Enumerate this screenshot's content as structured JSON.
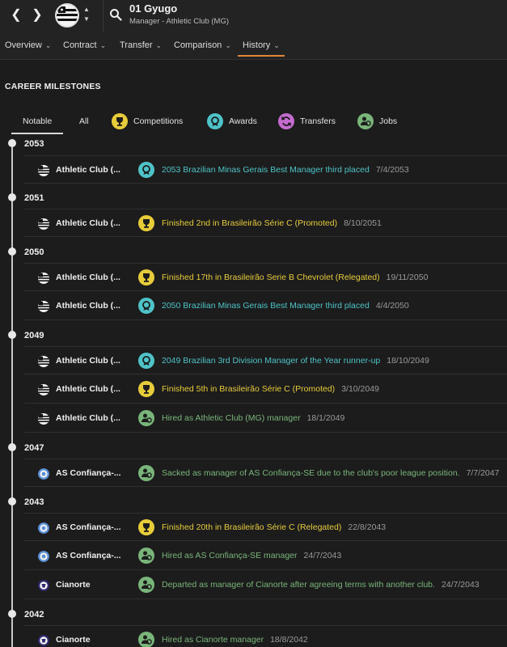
{
  "header": {
    "person_name": "01 Gyugo",
    "person_role": "Manager - Athletic Club (MG)"
  },
  "tabs": [
    {
      "label": "Overview"
    },
    {
      "label": "Contract"
    },
    {
      "label": "Transfer"
    },
    {
      "label": "Comparison"
    },
    {
      "label": "History"
    }
  ],
  "section_title": "CAREER MILESTONES",
  "filters": [
    {
      "label": "Notable"
    },
    {
      "label": "All"
    },
    {
      "label": "Competitions",
      "icon": "trophy-icon",
      "color": "#e7cc3a"
    },
    {
      "label": "Awards",
      "icon": "medal-icon",
      "color": "#4ec3c8"
    },
    {
      "label": "Transfers",
      "icon": "transfer-icon",
      "color": "#c56bd0"
    },
    {
      "label": "Jobs",
      "icon": "manager-icon",
      "color": "#79b57a"
    }
  ],
  "years": [
    {
      "year": "2053",
      "events": [
        {
          "club": "Athletic Club (...",
          "type": "award",
          "text": "2053 Brazilian Minas Gerais Best Manager third placed",
          "date": "7/4/2053"
        }
      ]
    },
    {
      "year": "2051",
      "events": [
        {
          "club": "Athletic Club (...",
          "type": "competition",
          "text": "Finished 2nd in Brasileirão Série C (Promoted)",
          "date": "8/10/2051"
        }
      ]
    },
    {
      "year": "2050",
      "events": [
        {
          "club": "Athletic Club (...",
          "type": "competition",
          "text": "Finished 17th in Brasileirão Serie B Chevrolet (Relegated)",
          "date": "19/11/2050"
        },
        {
          "club": "Athletic Club (...",
          "type": "award",
          "text": "2050 Brazilian Minas Gerais Best Manager third placed",
          "date": "4/4/2050"
        }
      ]
    },
    {
      "year": "2049",
      "events": [
        {
          "club": "Athletic Club (...",
          "type": "award",
          "text": "2049 Brazilian 3rd Division Manager of the Year runner-up",
          "date": "18/10/2049"
        },
        {
          "club": "Athletic Club (...",
          "type": "competition",
          "text": "Finished 5th in Brasileirão Série C (Promoted)",
          "date": "3/10/2049"
        },
        {
          "club": "Athletic Club (...",
          "type": "job",
          "text": "Hired as Athletic Club (MG) manager",
          "date": "18/1/2049"
        }
      ]
    },
    {
      "year": "2047",
      "events": [
        {
          "club": "AS Confiança-...",
          "type": "job",
          "text": "Sacked as manager of AS Confiança-SE due to the club's poor league position.",
          "date": "7/7/2047"
        }
      ]
    },
    {
      "year": "2043",
      "events": [
        {
          "club": "AS Confiança-...",
          "type": "competition",
          "text": "Finished 20th in Brasileirão Série C (Relegated)",
          "date": "22/8/2043"
        },
        {
          "club": "AS Confiança-...",
          "type": "job",
          "text": "Hired as AS Confiança-SE manager",
          "date": "24/7/2043"
        },
        {
          "club": "Cianorte",
          "type": "job",
          "text": "Departed as manager of Cianorte after agreeing terms with another club.",
          "date": "24/7/2043"
        }
      ]
    },
    {
      "year": "2042",
      "events": [
        {
          "club": "Cianorte",
          "type": "job",
          "text": "Hired as Cianorte manager",
          "date": "18/8/2042"
        }
      ]
    }
  ]
}
